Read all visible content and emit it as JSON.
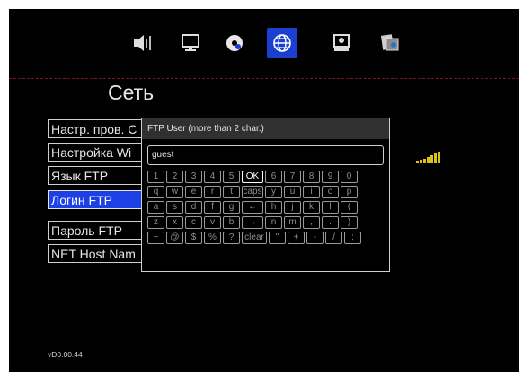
{
  "colors": {
    "accent": "#1c3fe6",
    "background": "#000000",
    "divider": "#7a1a1a",
    "signal": "#d8c21a"
  },
  "topbar": {
    "icons": [
      {
        "name": "speaker-icon"
      },
      {
        "name": "monitor-icon"
      },
      {
        "name": "disc-icon"
      },
      {
        "name": "globe-network-icon",
        "active": true
      },
      {
        "name": "settings-box-icon"
      },
      {
        "name": "photo-icon"
      }
    ]
  },
  "page": {
    "title": "Сеть"
  },
  "menu": {
    "items": [
      {
        "label": "Настр. пров. С"
      },
      {
        "label": "Настройка Wi"
      },
      {
        "label": "Язык FTP"
      },
      {
        "label": "Логин FTP",
        "selected": true
      },
      {
        "label": "Пароль FTP"
      },
      {
        "label": "NET Host Nam"
      }
    ]
  },
  "keyboard": {
    "header": "FTP User (more than 2 char.)",
    "value": "guest",
    "rows": [
      [
        "1",
        "2",
        "3",
        "4",
        "5",
        "OK",
        "6",
        "7",
        "8",
        "9",
        "0"
      ],
      [
        "q",
        "w",
        "e",
        "r",
        "t",
        "caps",
        "y",
        "u",
        "i",
        "o",
        "p"
      ],
      [
        "a",
        "s",
        "d",
        "f",
        "g",
        "←",
        "h",
        "j",
        "k",
        "l",
        "("
      ],
      [
        "z",
        "x",
        "c",
        "v",
        "b",
        "→",
        "n",
        "m",
        ",",
        ".",
        ")"
      ],
      [
        "~",
        "@",
        "$",
        "%",
        "?",
        "clear",
        "\"",
        "+",
        "-",
        "/",
        ";"
      ]
    ],
    "highlighted": "OK"
  },
  "footer": {
    "version": "vD0.00.44"
  }
}
